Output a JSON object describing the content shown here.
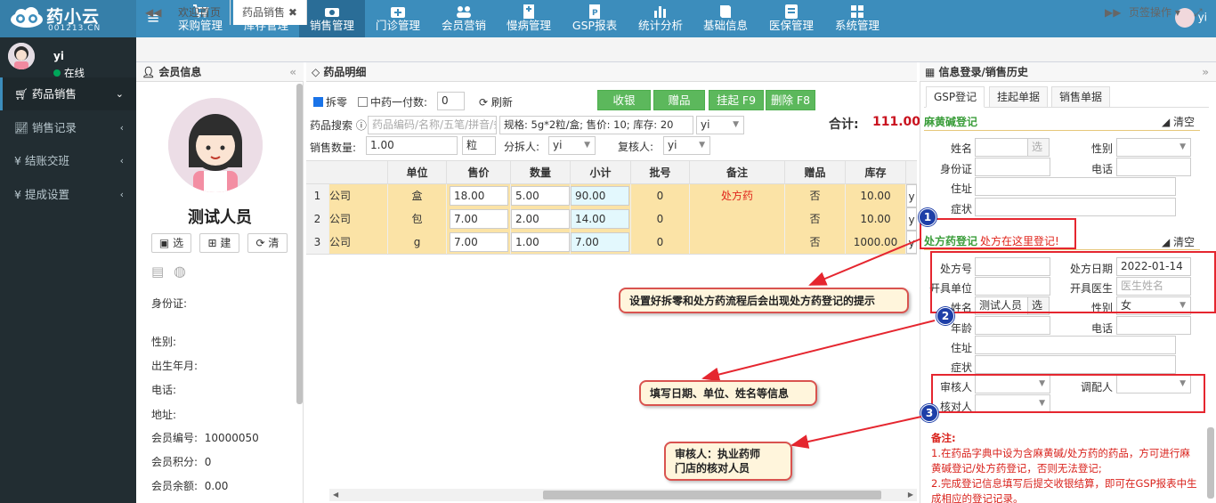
{
  "app": {
    "logo_title": "药小云",
    "logo_sub": "001213.CN"
  },
  "nav": {
    "items": [
      {
        "label": "采购管理",
        "icon": "cart-icon"
      },
      {
        "label": "库存管理",
        "icon": "box-icon"
      },
      {
        "label": "销售管理",
        "icon": "phone-icon"
      },
      {
        "label": "门诊管理",
        "icon": "medkit-icon"
      },
      {
        "label": "会员营销",
        "icon": "users-icon"
      },
      {
        "label": "慢病管理",
        "icon": "hospital-icon"
      },
      {
        "label": "GSP报表",
        "icon": "doc-p-icon"
      },
      {
        "label": "统计分析",
        "icon": "bar-chart-icon"
      },
      {
        "label": "基础信息",
        "icon": "book-icon"
      },
      {
        "label": "医保管理",
        "icon": "idcard-icon"
      },
      {
        "label": "系统管理",
        "icon": "windows-icon"
      }
    ],
    "active": "销售管理"
  },
  "user": {
    "name": "yi",
    "status": "在线"
  },
  "sidebar": {
    "items": [
      {
        "label": "药品销售",
        "icon": "cart-icon"
      },
      {
        "label": "销售记录",
        "icon": "line-chart-icon"
      },
      {
        "label": "结账交班",
        "icon": "yen-icon"
      },
      {
        "label": "提成设置",
        "icon": "yen-icon"
      }
    ]
  },
  "tabs": {
    "items": [
      {
        "label": "欢迎首页"
      },
      {
        "label": "药品销售"
      }
    ],
    "ops": "页签操作"
  },
  "member": {
    "title": "会员信息",
    "name": "测试人员",
    "buttons": {
      "select": "选",
      "create": "建",
      "clear": "清"
    },
    "fields": {
      "idcard": "身份证:",
      "gender": "性别:",
      "birth": "出生年月:",
      "phone": "电话:",
      "address": "地址:",
      "member_no_label": "会员编号:",
      "member_no": "10000050",
      "points_label": "会员积分:",
      "points": "0",
      "balance_label": "会员余额:",
      "balance": "0.00"
    }
  },
  "sales": {
    "title": "药品明细",
    "split_label": "拆零",
    "tcm_label": "中药一付数:",
    "tcm_value": "0",
    "refresh": "刷新",
    "buttons": {
      "collect": "收银",
      "gift": "赠品",
      "hang": "挂起 F9",
      "delete": "删除 F8"
    },
    "search_label": "药品搜索",
    "search_placeholder": "药品编码/名称/五笔/拼音/条",
    "spec": "规格: 5g*2粒/盒; 售价: 10; 库存: 20",
    "spec_sel": "yi",
    "qty_label": "销售数量:",
    "qty": "1.00",
    "unit": "粒",
    "splitter_label": "分拆人:",
    "splitter": "yi",
    "reviewer_label": "复核人:",
    "reviewer": "yi",
    "total_label": "合计:",
    "total": "111.00",
    "columns": [
      "",
      "单位",
      "售价",
      "数量",
      "小计",
      "批号",
      "备注",
      "赠品",
      "库存",
      ""
    ],
    "rows": [
      {
        "no": "1",
        "co": "公司",
        "unit": "盒",
        "price": "18.00",
        "qty": "5.00",
        "sub": "90.00",
        "batch": "0",
        "note": "处方药",
        "gift": "否",
        "stock": "10.00",
        "last": "y"
      },
      {
        "no": "2",
        "co": "公司",
        "unit": "包",
        "price": "7.00",
        "qty": "2.00",
        "sub": "14.00",
        "batch": "0",
        "note": "",
        "gift": "否",
        "stock": "10.00",
        "last": "y"
      },
      {
        "no": "3",
        "co": "公司",
        "unit": "g",
        "price": "7.00",
        "qty": "1.00",
        "sub": "7.00",
        "batch": "0",
        "note": "",
        "gift": "否",
        "stock": "1000.00",
        "last": "y"
      }
    ]
  },
  "info": {
    "title": "信息登录/销售历史",
    "tabs": [
      "GSP登记",
      "挂起单据",
      "销售单据"
    ],
    "mahuang": {
      "title": "麻黄碱登记",
      "clear": "清空",
      "name": "姓名",
      "select": "选",
      "gender": "性别",
      "idcard": "身份证",
      "phone": "电话",
      "address": "住址",
      "symptom": "症状"
    },
    "rx": {
      "title": "处方药登记",
      "hint": "处方在这里登记!",
      "clear": "清空",
      "rx_no": "处方号",
      "rx_date": "处方日期",
      "rx_date_val": "2022-01-14",
      "unit": "开具单位",
      "doctor": "开具医生",
      "doctor_ph": "医生姓名",
      "name": "姓名",
      "name_val": "测试人员",
      "select": "选",
      "gender": "性别",
      "gender_val": "女",
      "age": "年龄",
      "phone": "电话",
      "address": "住址",
      "symptom": "症状",
      "reviewer": "审核人",
      "dispenser": "调配人",
      "checker": "核对人"
    },
    "notes": {
      "title": "备注:",
      "l1": "1.在药品字典中设为含麻黄碱/处方药的药品，方可进行麻黄碱登记/处方药登记，否则无法登记;",
      "l2": "2.完成登记信息填写后提交收银结算，即可在GSP报表中生成相应的登记记录。"
    }
  },
  "annotations": {
    "n1": "1",
    "n2": "2",
    "n3": "3",
    "c1": "设置好拆零和处方药流程后会出现处方药登记的提示",
    "c2": "填写日期、单位、姓名等信息",
    "c3a": "审核人：执业药师",
    "c3b": "门店的核对人员"
  },
  "colors": {
    "nav": "#3c8dbc",
    "sidebar": "#222d32",
    "green": "#5cb85c",
    "row_yellow": "#fbe3a6",
    "red": "#e5262f"
  }
}
